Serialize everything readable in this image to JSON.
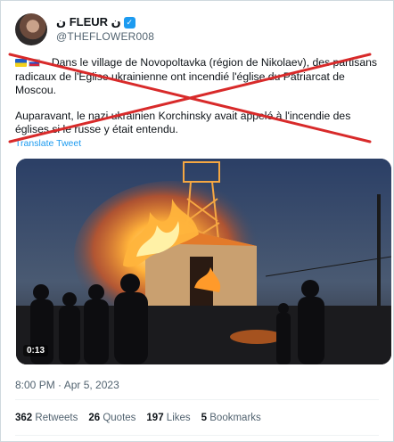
{
  "author": {
    "display_name": "ن FLEUR ن",
    "handle": "@THEFLOWER008",
    "verified_icon": "verified-badge-icon"
  },
  "tweet": {
    "paragraph1": "Dans le village de Novopoltavka (région de Nikolaev), des partisans radicaux de l'Église ukrainienne ont incendié l'église du Patriarcat de Moscou.",
    "paragraph2": "Auparavant, le nazi ukrainien Korchinsky avait appelé à l'incendie des églises si le russe y était entendu.",
    "translate_label": "Translate Tweet",
    "flags": [
      "flag-ukraine-icon",
      "flag-russia-icon"
    ]
  },
  "media": {
    "duration": "0:13",
    "description_icon": "video-thumbnail"
  },
  "meta": {
    "timestamp": "8:00 PM · Apr 5, 2023"
  },
  "stats": {
    "retweets_count": "362",
    "retweets_label": "Retweets",
    "quotes_count": "26",
    "quotes_label": "Quotes",
    "likes_count": "197",
    "likes_label": "Likes",
    "bookmarks_count": "5",
    "bookmarks_label": "Bookmarks"
  },
  "colors": {
    "link": "#1d9bf0",
    "cross": "#d82a2a",
    "muted": "#536471"
  }
}
